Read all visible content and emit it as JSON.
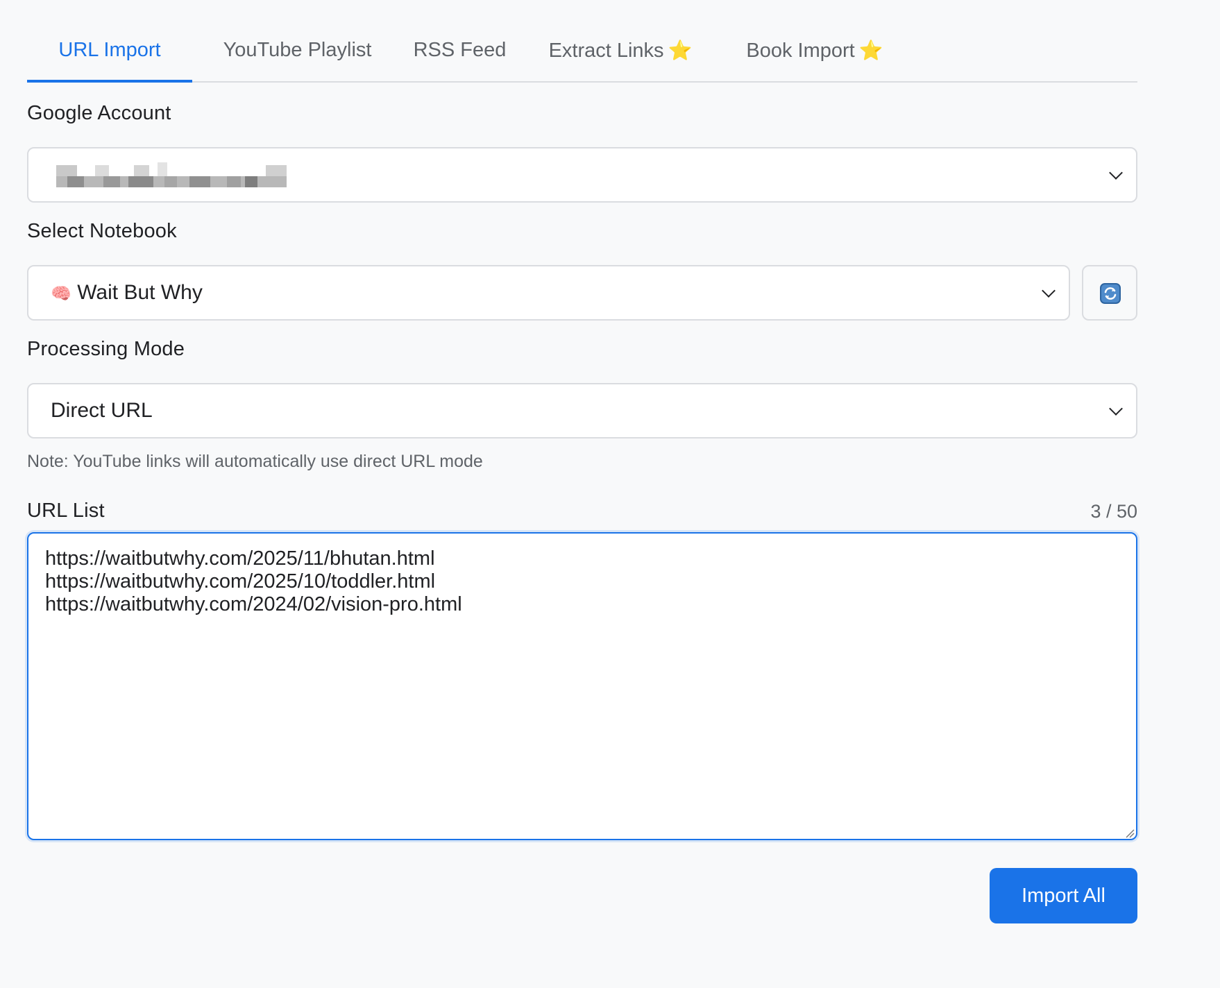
{
  "tabs": [
    {
      "label": "URL Import",
      "active": true,
      "star": false
    },
    {
      "label": "YouTube Playlist",
      "active": false,
      "star": false
    },
    {
      "label": "RSS Feed",
      "active": false,
      "star": false
    },
    {
      "label": "Extract Links",
      "active": false,
      "star": true
    },
    {
      "label": "Book Import",
      "active": false,
      "star": true
    }
  ],
  "star_glyph": "⭐",
  "google_account": {
    "label": "Google Account",
    "value_redacted": true
  },
  "notebook": {
    "label": "Select Notebook",
    "emoji": "🧠",
    "value": "Wait But Why"
  },
  "processing_mode": {
    "label": "Processing Mode",
    "value": "Direct URL",
    "note": "Note: YouTube links will automatically use direct URL mode"
  },
  "url_list": {
    "label": "URL List",
    "counter": "3 / 50",
    "value": "https://waitbutwhy.com/2025/11/bhutan.html\nhttps://waitbutwhy.com/2025/10/toddler.html\nhttps://waitbutwhy.com/2024/02/vision-pro.html"
  },
  "import_button": {
    "label": "Import All"
  },
  "colors": {
    "accent": "#1a73e8",
    "background": "#f8f9fa",
    "border": "#dadce0"
  }
}
